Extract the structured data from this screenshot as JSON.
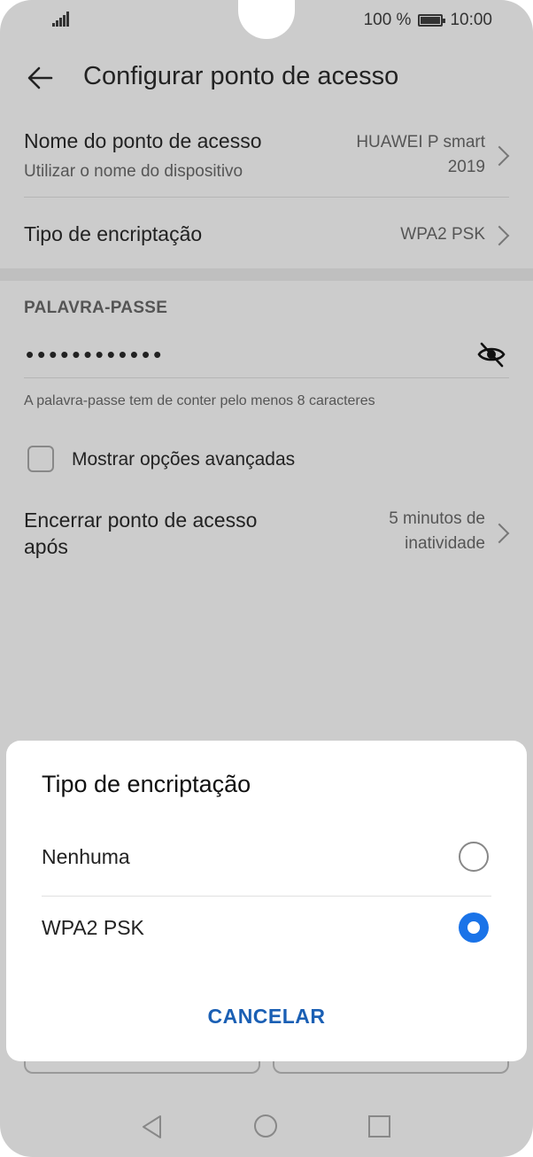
{
  "status_bar": {
    "battery": "100 %",
    "time": "10:00",
    "battery_level": 1.0,
    "signal_icon": "signal-icon",
    "battery_icon": "battery-icon"
  },
  "appbar": {
    "title": "Configurar ponto de acesso",
    "back_icon": "arrow-left-icon"
  },
  "settings": {
    "ap_name": {
      "title": "Nome do ponto de acesso",
      "subtitle": "Utilizar o nome do dispositivo",
      "value_line1": "HUAWEI P smart",
      "value_line2": "2019"
    },
    "encryption": {
      "title": "Tipo de encriptação",
      "value": "WPA2 PSK"
    },
    "password": {
      "header": "PALAVRA-PASSE",
      "masked": "••••••••••••",
      "hint": "A palavra-passe tem de conter pelo menos 8 caracteres",
      "eye_icon": "eye-off-icon"
    },
    "advanced": {
      "label": "Mostrar opções avançadas",
      "checked": false
    },
    "shutdown": {
      "title_line1": "Encerrar ponto de acesso",
      "title_line2": "após",
      "value_line1": "5 minutos de",
      "value_line2": "inatividade"
    }
  },
  "dialog": {
    "title": "Tipo de encriptação",
    "options": [
      {
        "label": "Nenhuma",
        "selected": false
      },
      {
        "label": "WPA2 PSK",
        "selected": true
      }
    ],
    "cancel": "CANCELAR",
    "accent_color": "#1a73e8"
  },
  "navbar": {
    "back_icon": "nav-back-icon",
    "home_icon": "nav-home-icon",
    "recent_icon": "nav-recent-icon"
  }
}
